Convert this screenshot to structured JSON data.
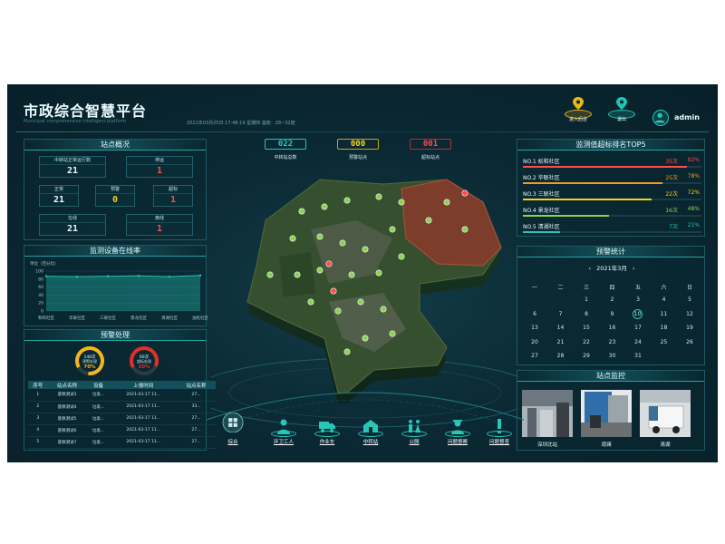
{
  "header": {
    "title": "市政综合智慧平台",
    "subtitle": "Municipal comprehensive intelligent platform",
    "datetime": "2021年03月25日  17:48:19  星期四   温度：28~32度",
    "buttons": [
      {
        "label": "进入后台",
        "icon": "location-pin-icon",
        "color": "#e9b61a"
      },
      {
        "label": "退出",
        "icon": "location-pin-icon",
        "color": "#1fc6b4"
      }
    ],
    "user": "admin"
  },
  "overview": {
    "title": "站点概况",
    "cells": [
      {
        "label": "中转站正常运行数",
        "value": "21",
        "color": "#e9fbff"
      },
      {
        "label": "停运",
        "value": "1",
        "color": "#ff4d4d"
      },
      {
        "label": "正常",
        "value": "21",
        "color": "#e9fbff"
      },
      {
        "label": "预警",
        "value": "0",
        "color": "#f6d21d"
      },
      {
        "label": "超标",
        "value": "1",
        "color": "#ff4d4d"
      },
      {
        "label": "在线",
        "value": "21",
        "color": "#e9fbff"
      },
      {
        "label": "离线",
        "value": "1",
        "color": "#ff4d4d"
      }
    ]
  },
  "online_rate": {
    "title": "监测设备在线率",
    "unit_label": "单位（百分比）"
  },
  "chart_data": {
    "type": "area",
    "title": "监测设备在线率",
    "ylabel": "单位（百分比）",
    "categories": [
      "和和社区",
      "华联社区",
      "三联社区",
      "景龙社区",
      "清湖社区",
      "油松社区"
    ],
    "values": [
      87,
      86,
      87,
      88,
      86,
      89
    ],
    "ylim": [
      0,
      100
    ],
    "yticks": [
      0,
      20,
      40,
      60,
      80,
      100
    ]
  },
  "warning": {
    "title": "预警处理",
    "gauges": [
      {
        "count": "148次",
        "label": "预警处理",
        "percent": "70%",
        "fraction": 0.7,
        "color": "#f5b51b"
      },
      {
        "count": "60次",
        "label": "超标处理",
        "percent": "30%",
        "fraction": 0.3,
        "color": "#e0302b"
      }
    ],
    "columns": [
      "序号",
      "站点名称",
      "设备",
      "上报时间",
      "站点名称"
    ],
    "rows": [
      [
        "1",
        "基佩测试3",
        "垃圾...",
        "2021-03-17 11...",
        "27..."
      ],
      [
        "2",
        "基佩测试4",
        "垃圾...",
        "2021-03-17 11...",
        "33..."
      ],
      [
        "3",
        "基佩测试5",
        "垃圾...",
        "2021-03-17 11...",
        "27..."
      ],
      [
        "4",
        "基佩测试6",
        "垃圾...",
        "2021-03-17 11...",
        "27..."
      ],
      [
        "5",
        "基佩测试7",
        "垃圾...",
        "2021-03-17 11...",
        "27..."
      ]
    ]
  },
  "counters": [
    {
      "value": "022",
      "label": "中转站总数",
      "color": "#27c6b6"
    },
    {
      "value": "000",
      "label": "预警站点",
      "color": "#f6d21d"
    },
    {
      "value": "001",
      "label": "超标站点",
      "color": "#ff4d4d"
    }
  ],
  "top5": {
    "title": "监测值超标排名TOP5",
    "rows": [
      {
        "name": "NO.1  松和社区",
        "count": "35次",
        "pct": "92%",
        "fraction": 0.92,
        "color": "#ff4d4d"
      },
      {
        "name": "NO.2  华联社区",
        "count": "25次",
        "pct": "78%",
        "fraction": 0.78,
        "color": "#f59b1b"
      },
      {
        "name": "NO.3  三联社区",
        "count": "22次",
        "pct": "72%",
        "fraction": 0.72,
        "color": "#f6d21d"
      },
      {
        "name": "NO.4  景龙社区",
        "count": "16次",
        "pct": "48%",
        "fraction": 0.48,
        "color": "#8fd14f"
      },
      {
        "name": "NO.5  清湖社区",
        "count": "7次",
        "pct": "21%",
        "fraction": 0.21,
        "color": "#27c6b6"
      }
    ]
  },
  "calendar": {
    "title": "预警统计",
    "month": "2021年3月",
    "prev": "‹",
    "next": "›",
    "weekdays": [
      "一",
      "二",
      "三",
      "四",
      "五",
      "六",
      "日"
    ],
    "days": [
      "1",
      "2",
      "3",
      "4",
      "5",
      "6",
      "7",
      "8",
      "9",
      "10",
      "11",
      "12",
      "13",
      "14",
      "15",
      "16",
      "17",
      "18",
      "19",
      "20",
      "21",
      "22",
      "23",
      "24",
      "25",
      "26",
      "27",
      "28",
      "29",
      "30",
      "31"
    ],
    "highlight": "10"
  },
  "monitor": {
    "title": "站点监控",
    "cams": [
      "深圳北站",
      "观澜",
      "清湖"
    ]
  },
  "nav": [
    {
      "label": "综合",
      "icon": "grid-icon"
    },
    {
      "label": "环卫工人",
      "icon": "worker-icon"
    },
    {
      "label": "作业车",
      "icon": "truck-icon"
    },
    {
      "label": "中转站",
      "icon": "station-icon"
    },
    {
      "label": "公厕",
      "icon": "toilet-icon"
    },
    {
      "label": "问题督察",
      "icon": "inspector-icon"
    },
    {
      "label": "问题督查",
      "icon": "alert-icon"
    }
  ]
}
